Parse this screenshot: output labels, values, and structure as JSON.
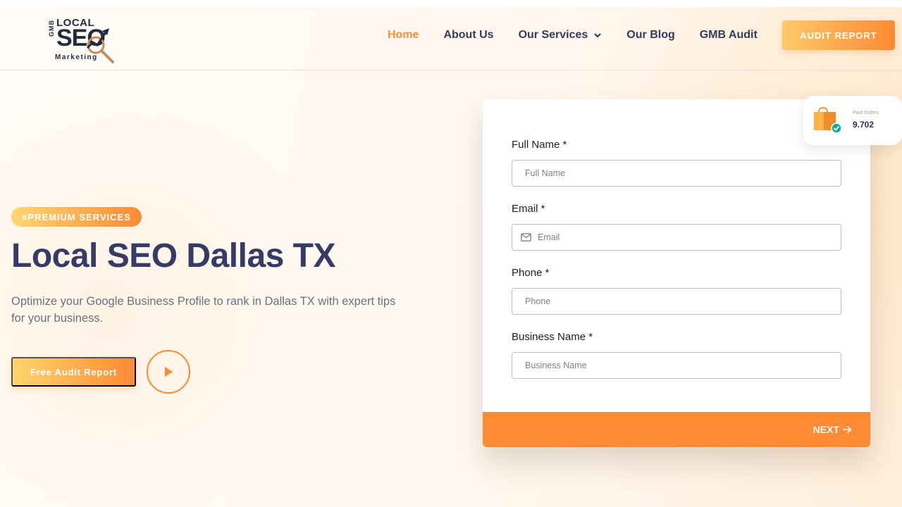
{
  "brand": {
    "logo_top": "LOCAL",
    "logo_main": "SEO",
    "logo_side": "GMB",
    "logo_bottom": "Marketing"
  },
  "nav": {
    "items": [
      {
        "label": "Home",
        "active": true
      },
      {
        "label": "About Us"
      },
      {
        "label": "Our Services",
        "has_dropdown": true
      },
      {
        "label": "Our Blog"
      },
      {
        "label": "GMB Audit"
      }
    ],
    "cta_label": "AUDIT REPORT"
  },
  "hero": {
    "badge": "#PREMIUM SERVICES",
    "title": "Local SEO Dallas TX",
    "description": "Optimize your Google Business Profile to rank in Dallas TX with expert tips for your business.",
    "cta_label": "Free Audit Report",
    "play_icon": "play-icon"
  },
  "form": {
    "fields": [
      {
        "label": "Full Name *",
        "placeholder": "Full Name"
      },
      {
        "label": "Email *",
        "placeholder": "Email",
        "icon": "mail-icon"
      },
      {
        "label": "Phone *",
        "placeholder": "Phone"
      },
      {
        "label": "Business Name *",
        "placeholder": "Business Name"
      }
    ],
    "next_label": "NEXT"
  },
  "orders_widget": {
    "label": "Paid Orders",
    "value": "9.702"
  },
  "colors": {
    "accent": "#ff8a34",
    "accent_light": "#ffd66d",
    "heading": "#353a66",
    "body_text": "#6b6f80"
  }
}
